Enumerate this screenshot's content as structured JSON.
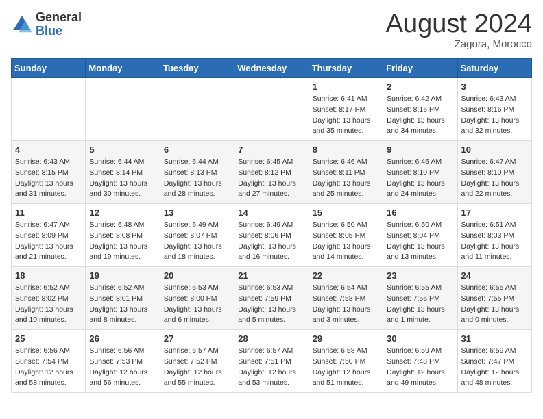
{
  "logo": {
    "general": "General",
    "blue": "Blue"
  },
  "title": "August 2024",
  "location": "Zagora, Morocco",
  "weekdays": [
    "Sunday",
    "Monday",
    "Tuesday",
    "Wednesday",
    "Thursday",
    "Friday",
    "Saturday"
  ],
  "weeks": [
    [
      {
        "day": "",
        "info": ""
      },
      {
        "day": "",
        "info": ""
      },
      {
        "day": "",
        "info": ""
      },
      {
        "day": "",
        "info": ""
      },
      {
        "day": "1",
        "info": "Sunrise: 6:41 AM\nSunset: 8:17 PM\nDaylight: 13 hours\nand 35 minutes."
      },
      {
        "day": "2",
        "info": "Sunrise: 6:42 AM\nSunset: 8:16 PM\nDaylight: 13 hours\nand 34 minutes."
      },
      {
        "day": "3",
        "info": "Sunrise: 6:43 AM\nSunset: 8:16 PM\nDaylight: 13 hours\nand 32 minutes."
      }
    ],
    [
      {
        "day": "4",
        "info": "Sunrise: 6:43 AM\nSunset: 8:15 PM\nDaylight: 13 hours\nand 31 minutes."
      },
      {
        "day": "5",
        "info": "Sunrise: 6:44 AM\nSunset: 8:14 PM\nDaylight: 13 hours\nand 30 minutes."
      },
      {
        "day": "6",
        "info": "Sunrise: 6:44 AM\nSunset: 8:13 PM\nDaylight: 13 hours\nand 28 minutes."
      },
      {
        "day": "7",
        "info": "Sunrise: 6:45 AM\nSunset: 8:12 PM\nDaylight: 13 hours\nand 27 minutes."
      },
      {
        "day": "8",
        "info": "Sunrise: 6:46 AM\nSunset: 8:11 PM\nDaylight: 13 hours\nand 25 minutes."
      },
      {
        "day": "9",
        "info": "Sunrise: 6:46 AM\nSunset: 8:10 PM\nDaylight: 13 hours\nand 24 minutes."
      },
      {
        "day": "10",
        "info": "Sunrise: 6:47 AM\nSunset: 8:10 PM\nDaylight: 13 hours\nand 22 minutes."
      }
    ],
    [
      {
        "day": "11",
        "info": "Sunrise: 6:47 AM\nSunset: 8:09 PM\nDaylight: 13 hours\nand 21 minutes."
      },
      {
        "day": "12",
        "info": "Sunrise: 6:48 AM\nSunset: 8:08 PM\nDaylight: 13 hours\nand 19 minutes."
      },
      {
        "day": "13",
        "info": "Sunrise: 6:49 AM\nSunset: 8:07 PM\nDaylight: 13 hours\nand 18 minutes."
      },
      {
        "day": "14",
        "info": "Sunrise: 6:49 AM\nSunset: 8:06 PM\nDaylight: 13 hours\nand 16 minutes."
      },
      {
        "day": "15",
        "info": "Sunrise: 6:50 AM\nSunset: 8:05 PM\nDaylight: 13 hours\nand 14 minutes."
      },
      {
        "day": "16",
        "info": "Sunrise: 6:50 AM\nSunset: 8:04 PM\nDaylight: 13 hours\nand 13 minutes."
      },
      {
        "day": "17",
        "info": "Sunrise: 6:51 AM\nSunset: 8:03 PM\nDaylight: 13 hours\nand 11 minutes."
      }
    ],
    [
      {
        "day": "18",
        "info": "Sunrise: 6:52 AM\nSunset: 8:02 PM\nDaylight: 13 hours\nand 10 minutes."
      },
      {
        "day": "19",
        "info": "Sunrise: 6:52 AM\nSunset: 8:01 PM\nDaylight: 13 hours\nand 8 minutes."
      },
      {
        "day": "20",
        "info": "Sunrise: 6:53 AM\nSunset: 8:00 PM\nDaylight: 13 hours\nand 6 minutes."
      },
      {
        "day": "21",
        "info": "Sunrise: 6:53 AM\nSunset: 7:59 PM\nDaylight: 13 hours\nand 5 minutes."
      },
      {
        "day": "22",
        "info": "Sunrise: 6:54 AM\nSunset: 7:58 PM\nDaylight: 13 hours\nand 3 minutes."
      },
      {
        "day": "23",
        "info": "Sunrise: 6:55 AM\nSunset: 7:56 PM\nDaylight: 13 hours\nand 1 minute."
      },
      {
        "day": "24",
        "info": "Sunrise: 6:55 AM\nSunset: 7:55 PM\nDaylight: 13 hours\nand 0 minutes."
      }
    ],
    [
      {
        "day": "25",
        "info": "Sunrise: 6:56 AM\nSunset: 7:54 PM\nDaylight: 12 hours\nand 58 minutes."
      },
      {
        "day": "26",
        "info": "Sunrise: 6:56 AM\nSunset: 7:53 PM\nDaylight: 12 hours\nand 56 minutes."
      },
      {
        "day": "27",
        "info": "Sunrise: 6:57 AM\nSunset: 7:52 PM\nDaylight: 12 hours\nand 55 minutes."
      },
      {
        "day": "28",
        "info": "Sunrise: 6:57 AM\nSunset: 7:51 PM\nDaylight: 12 hours\nand 53 minutes."
      },
      {
        "day": "29",
        "info": "Sunrise: 6:58 AM\nSunset: 7:50 PM\nDaylight: 12 hours\nand 51 minutes."
      },
      {
        "day": "30",
        "info": "Sunrise: 6:59 AM\nSunset: 7:48 PM\nDaylight: 12 hours\nand 49 minutes."
      },
      {
        "day": "31",
        "info": "Sunrise: 6:59 AM\nSunset: 7:47 PM\nDaylight: 12 hours\nand 48 minutes."
      }
    ]
  ]
}
